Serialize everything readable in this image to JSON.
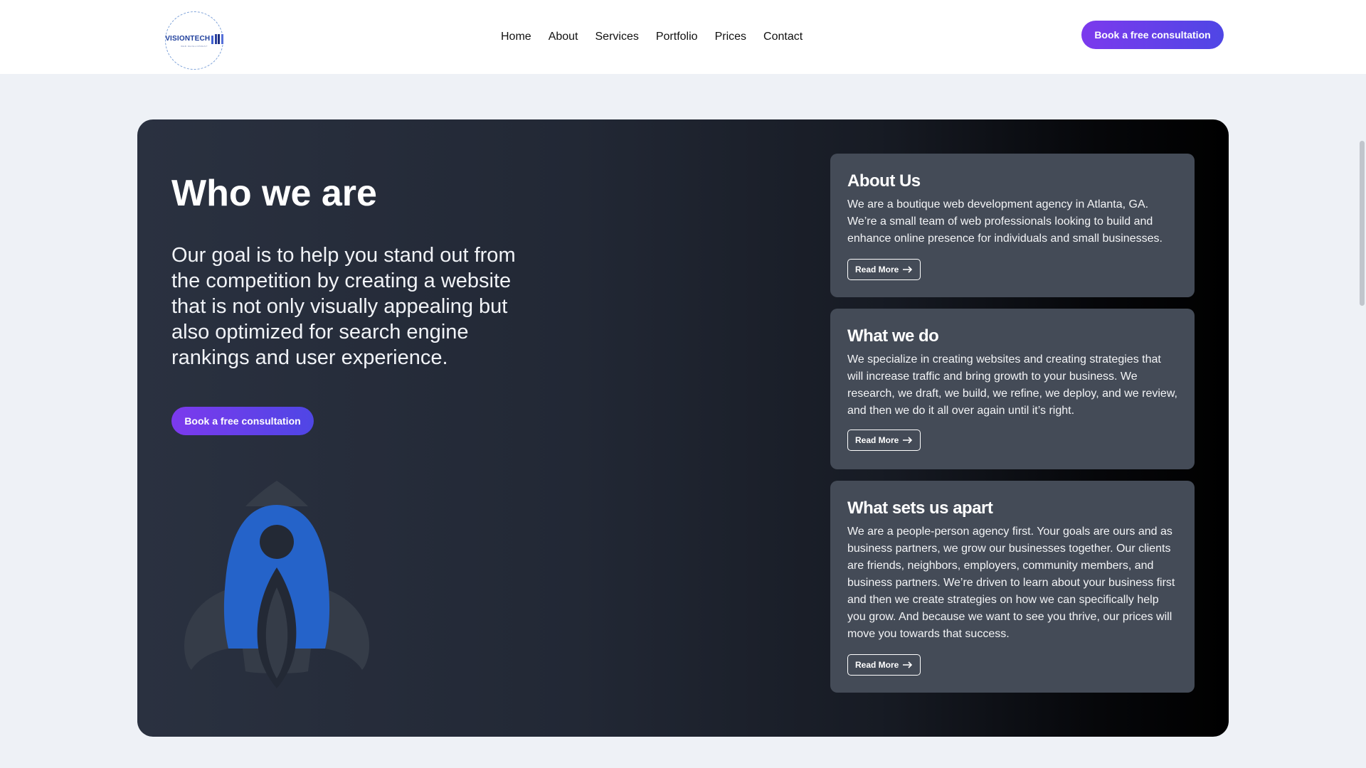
{
  "header": {
    "logo": {
      "text": "VISIONTECH",
      "tagline": "WEB DEVELOPMENT"
    },
    "nav": [
      {
        "label": "Home"
      },
      {
        "label": "About"
      },
      {
        "label": "Services"
      },
      {
        "label": "Portfolio"
      },
      {
        "label": "Prices"
      },
      {
        "label": "Contact"
      }
    ],
    "cta_label": "Book a free consultation"
  },
  "hero": {
    "title": "Who we are",
    "lead": "Our goal is to help you stand out from the competition by creating a website that is not only visually appealing but also optimized for search engine rankings and user experience.",
    "cta_label": "Book a free consultation",
    "illustration_icon": "rocket-icon"
  },
  "cards": [
    {
      "title": "About Us",
      "body": "We are a boutique web development agency in Atlanta, GA. We’re a small team of web professionals looking to build and enhance online presence for individuals and small businesses.",
      "link_label": "Read More"
    },
    {
      "title": "What we do",
      "body": "We specialize in creating websites and creating strategies that will increase traffic and bring growth to your business. We research, we draft, we build, we refine, we deploy, and we review, and then we do it all over again until it’s right.",
      "link_label": "Read More"
    },
    {
      "title": "What sets us apart",
      "body": "We are a people-person agency first. Your goals are ours and as business partners, we grow our businesses together. Our clients are friends, neighbors, employers, community members, and business partners. We’re driven to learn about your business first and then we create strategies on how we can specifically help you grow. And because we want to see you thrive, our prices will move you towards that success.",
      "link_label": "Read More"
    }
  ],
  "colors": {
    "accent_start": "#7c3aed",
    "accent_end": "#4f46e5",
    "panel_dark": "#222835",
    "card_bg": "#444b57",
    "rocket_blue": "#2563c9",
    "page_bg": "#eef1f6"
  }
}
